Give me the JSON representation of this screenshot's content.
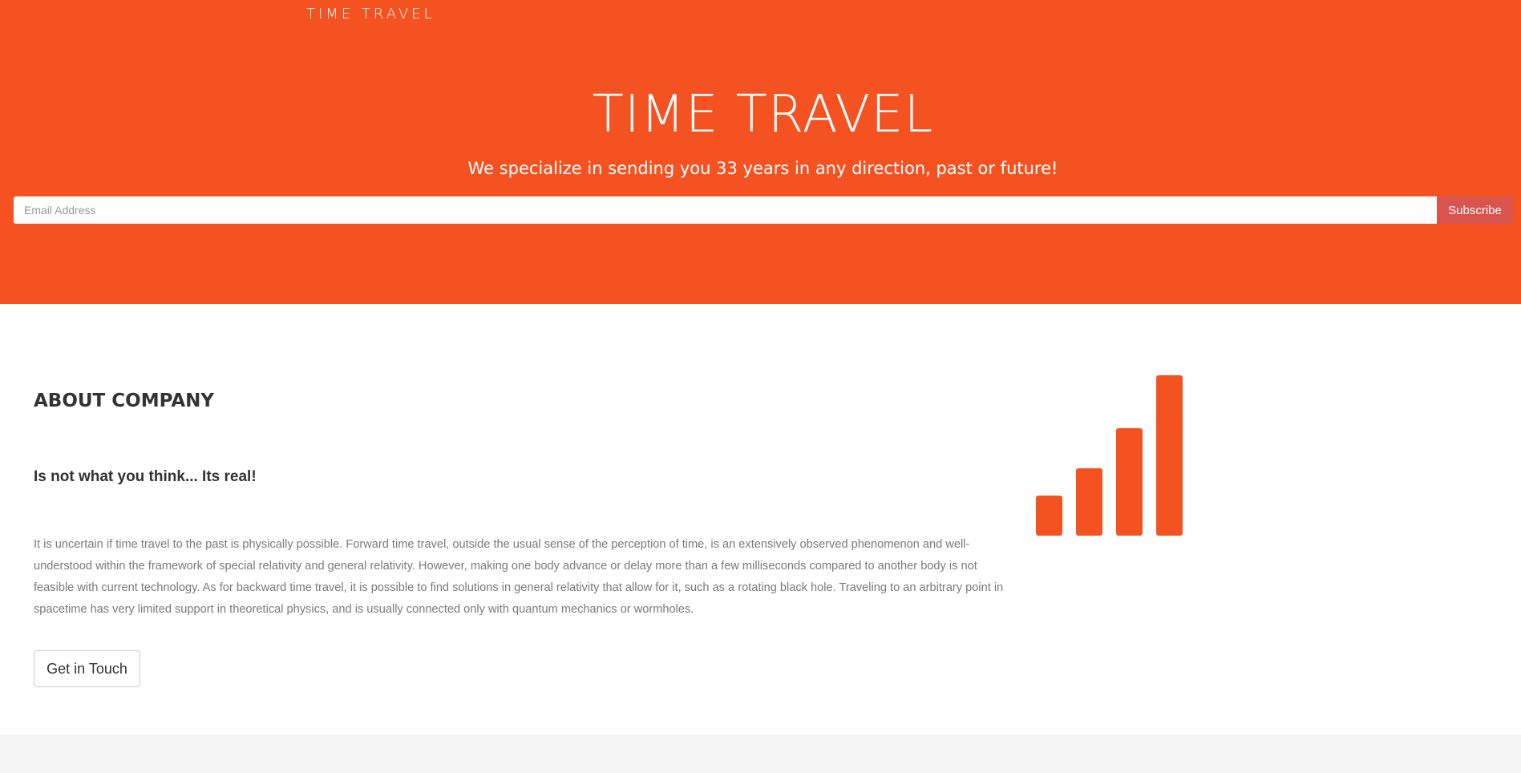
{
  "navbar": {
    "brand": "TIME TRAVEL"
  },
  "hero": {
    "title": "TIME TRAVEL",
    "subtitle": "We specialize in sending you 33 years in any direction, past or future!",
    "email_placeholder": "Email Address",
    "subscribe_label": "Subscribe"
  },
  "about": {
    "heading": "ABOUT COMPANY",
    "lead": "Is not what you think... Its real!",
    "body": "It is uncertain if time travel to the past is physically possible. Forward time travel, outside the usual sense of the perception of time, is an extensively observed phenomenon and well-understood within the framework of special relativity and general relativity. However, making one body advance or delay more than a few milliseconds compared to another body is not feasible with current technology. As for backward time travel, it is possible to find solutions in general relativity that allow for it, such as a rotating black hole. Traveling to an arbitrary point in spacetime has very limited support in theoretical physics, and is usually connected only with quantum mechanics or wormholes.",
    "cta_label": "Get in Touch",
    "icon": "signal-bars-icon"
  },
  "colors": {
    "accent": "#f55222",
    "subscribe_button": "#d9534f",
    "heading_text": "#333333",
    "body_text": "#7a7a7a",
    "footer_band": "#f5f5f5"
  }
}
